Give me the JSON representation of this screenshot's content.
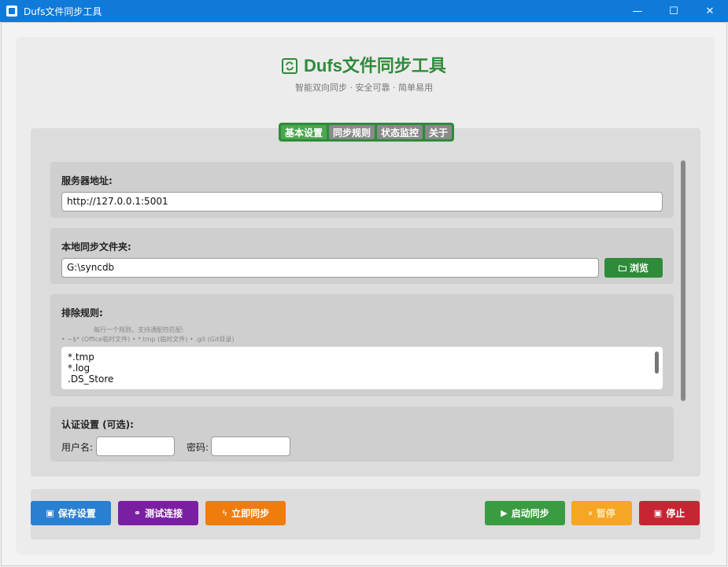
{
  "window": {
    "title": "Dufs文件同步工具",
    "minimize": "—",
    "maximize": "☐",
    "close": "✕"
  },
  "header": {
    "title": "Dufs文件同步工具",
    "subtitle": "智能双向同步 · 安全可靠 · 简单易用",
    "logo_icon": "sync-icon"
  },
  "tabs": [
    {
      "label": "基本设置",
      "active": true
    },
    {
      "label": "同步规则",
      "active": false
    },
    {
      "label": "状态监控",
      "active": false
    },
    {
      "label": "关于",
      "active": false
    }
  ],
  "server": {
    "label": "服务器地址:",
    "value": "http://127.0.0.1:5001"
  },
  "local_folder": {
    "label": "本地同步文件夹:",
    "value": "G:\\syncdb",
    "browse_label": "浏览",
    "browse_icon": "folder-icon"
  },
  "exclude": {
    "label": "排除规则:",
    "hint_line1": "每行一个规则，支持通配符匹配:",
    "hint_line2": "• ~$* (Office临时文件) • *.tmp (临时文件) • .git (Git目录)",
    "rules": [
      "*.tmp",
      "*.log",
      ".DS_Store"
    ]
  },
  "auth": {
    "label": "认证设置 (可选):",
    "username_label": "用户名:",
    "username_value": "",
    "password_label": "密码:",
    "password_value": ""
  },
  "actions": {
    "save": {
      "label": "保存设置",
      "color": "#2b7fd1",
      "icon": "save-icon"
    },
    "test": {
      "label": "测试连接",
      "color": "#7b1fa2",
      "icon": "link-icon"
    },
    "sync_now": {
      "label": "立即同步",
      "color": "#f07c0e",
      "icon": "lightning-icon"
    },
    "start": {
      "label": "启动同步",
      "color": "#3a9b41",
      "icon": "play-icon"
    },
    "pause": {
      "label": "暂停",
      "color": "#f5a623",
      "icon": "pause-icon"
    },
    "stop": {
      "label": "停止",
      "color": "#c62634",
      "icon": "stop-icon"
    }
  }
}
